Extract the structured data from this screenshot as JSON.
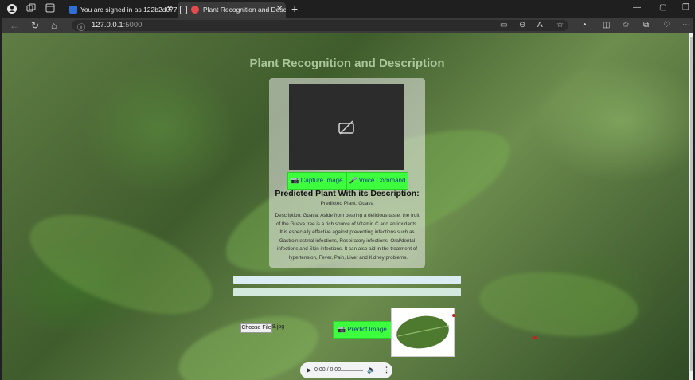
{
  "browser": {
    "tabs": [
      {
        "label": "You are signed in as 122b2d077",
        "favicon_color": "#2f6fd6",
        "favicon_letter": "S",
        "active": false
      },
      {
        "label": "Plant Recognition and Desc",
        "favicon_color": "#e34c4c",
        "active": true
      }
    ],
    "url": {
      "host": "127.0.0.1",
      "port": ":5000"
    }
  },
  "page": {
    "title": "Plant Recognition and Description",
    "buttons": {
      "capture": "Capture Image",
      "voice": "Voice Command",
      "predict": "Predict Image"
    },
    "prediction": {
      "heading": "Predicted Plant With its Description:",
      "plant_line": "Predicted Plant: Guava",
      "description": "Description: Guava: Aside from bearing a delicious taste, the fruit of the Guava tree is a rich source of Vitamin C and antioxidants. It is especially effective against preventing infections such as Gastrointestinal infections, Respiratory infections, Oral/dental infections and Skin infections. It can also aid in the treatment of Hypertension, Fever, Pain, Liver and Kidney problems."
    },
    "file_input": {
      "button": "Choose File",
      "file_name": "8.jpg"
    },
    "audio": {
      "time": "0:00 / 0:00"
    }
  },
  "colors": {
    "accent_green": "#3dff3d",
    "button_text": "#1a3a8a",
    "title_color": "#a9c79a"
  }
}
